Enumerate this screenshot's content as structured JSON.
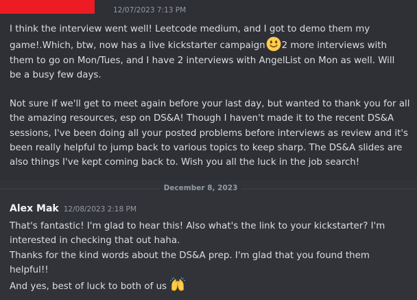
{
  "messages": [
    {
      "author": "",
      "timestamp": "12/07/2023 7:13 PM",
      "paragraphs": [
        [
          [
            "I think the interview went well! Leetcode medium, and I got to demo them my"
          ],
          [
            "game!.Which, btw, now has a live kickstarter campaign",
            "slightly-smiling-face-emoji",
            "2 more interviews with"
          ],
          [
            "them to go on Mon/Tues, and I have 2 interviews with AngelList on Mon as well. Will"
          ],
          [
            "be a busy few days."
          ]
        ],
        [
          [
            "Not sure if we'll get to meet again before your last day, but wanted to thank you for all"
          ],
          [
            "the amazing resources, esp on DS&A! Though I haven't made it to the recent DS&A"
          ],
          [
            "sessions, I've been doing all your posted problems before interviews as review and it's"
          ],
          [
            "been really helpful to jump back to various topics to keep sharp. The DS&A slides are"
          ],
          [
            "also things I've kept coming back to. Wish you all the luck in the job search!"
          ]
        ]
      ]
    },
    {
      "author": "Alex Mak",
      "timestamp": "12/08/2023 2:18 PM",
      "paragraphs": [
        [
          [
            "That's fantastic! I'm glad to hear this! Also what's the link to your kickstarter? I'm"
          ],
          [
            "interested in checking that out haha."
          ],
          [
            "Thanks for the kind words about the DS&A prep. I'm glad that you found them"
          ],
          [
            "helpful!!"
          ],
          [
            "And yes, best of luck to both of us",
            "raising-hands-emoji"
          ]
        ]
      ]
    }
  ],
  "date_divider": "December 8, 2023",
  "colors": {
    "background": "#313338",
    "hover_background": "#2e3035",
    "text": "#dbdee1",
    "author": "#f2f3f5",
    "timestamp": "#949ba4",
    "redaction": "#ed1c24",
    "divider_line": "#3f4147"
  }
}
